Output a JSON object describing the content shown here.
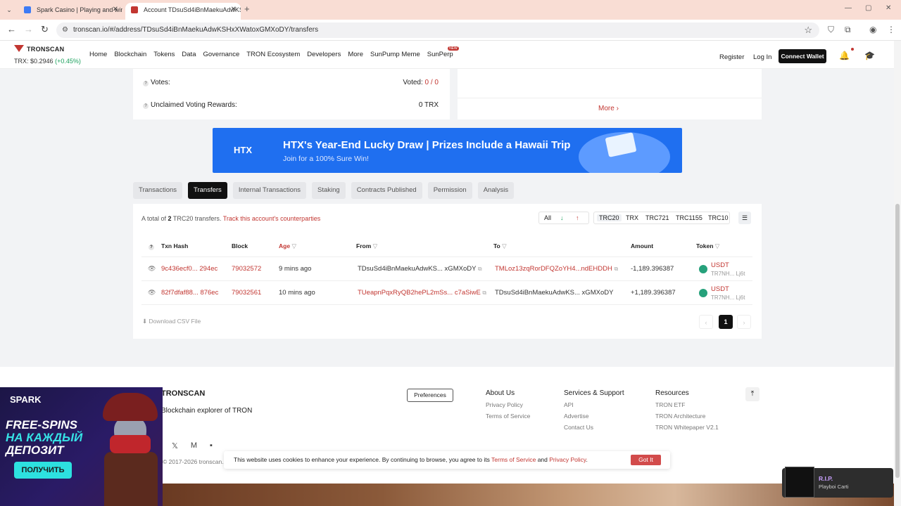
{
  "browser": {
    "tabs": [
      {
        "title": "Spark Casino | Playing and win",
        "favicon_color": "#3d7bf5"
      },
      {
        "title": "Account TDsuSd4iBnMaekuAdwKS...",
        "favicon_color": "#c23631"
      }
    ],
    "url": "tronscan.io/#/address/TDsuSd4iBnMaekuAdwKSHxXWatoxGMXoDY/transfers"
  },
  "header": {
    "logo": "TRONSCAN",
    "price_label": "TRX:",
    "price_value": "$0.2946",
    "price_change": "(+0.45%)",
    "nav": [
      "Home",
      "Blockchain",
      "Tokens",
      "Data",
      "Governance",
      "TRON Ecosystem",
      "Developers",
      "More",
      "SunPump Meme",
      "SunPerp"
    ],
    "register": "Register",
    "login": "Log In",
    "connect": "Connect Wallet"
  },
  "summary": {
    "votes_label": "Votes:",
    "votes_value_prefix": "Voted: ",
    "votes_value": "0 / 0",
    "rewards_label": "Unclaimed Voting Rewards:",
    "rewards_value": "0 TRX",
    "more": "More"
  },
  "banner": {
    "brand": "HTX",
    "headline": "HTX's Year-End Lucky Draw | Prizes Include a Hawaii Trip",
    "subline": "Join for a 100% Sure Win!"
  },
  "tabs": [
    "Transactions",
    "Transfers",
    "Internal Transactions",
    "Staking",
    "Contracts Published",
    "Permission",
    "Analysis"
  ],
  "transfers": {
    "total_prefix": "A total of ",
    "total_count": "2",
    "total_suffix": " TRC20 transfers.",
    "counterparties_link": "Track this account's counterparties",
    "direction": [
      "All",
      "↓",
      "↑"
    ],
    "token_types": [
      "TRC20",
      "TRX",
      "TRC721",
      "TRC1155",
      "TRC10"
    ],
    "columns": {
      "hash": "Txn Hash",
      "block": "Block",
      "age": "Age",
      "from": "From",
      "to": "To",
      "amount": "Amount",
      "token": "Token"
    },
    "rows": [
      {
        "hash": "9c436ecf0... 294ec",
        "block": "79032572",
        "age": "9 mins ago",
        "from": "TDsuSd4iBnMaekuAdwKS... xGMXoDY",
        "to": "TMLoz13zqRorDFQZoYH4...ndEHDDH",
        "amount": "-1,189.396387",
        "token": "USDT",
        "token_addr": "TR7NH... Lj6t"
      },
      {
        "hash": "82f7dfaf88... 876ec",
        "block": "79032561",
        "age": "10 mins ago",
        "from": "TUeapnPqxRyQB2hePL2mSs... c7aSiwE",
        "to": "TDsuSd4iBnMaekuAdwKS... xGMXoDY",
        "amount": "+1,189.396387",
        "token": "USDT",
        "token_addr": "TR7NH... Lj6t"
      }
    ],
    "csv": "Download CSV File",
    "page": "1"
  },
  "footer": {
    "brand": "TRONSCAN",
    "tagline": "Blockchain explorer of TRON",
    "copyright": "2017-2026 tronscan.io",
    "preferences": "Preferences",
    "about": {
      "title": "About Us",
      "items": [
        "Privacy Policy",
        "Terms of Service"
      ]
    },
    "services": {
      "title": "Services & Support",
      "items": [
        "API",
        "Advertise",
        "Contact Us"
      ]
    },
    "resources": {
      "title": "Resources",
      "items": [
        "TRON ETF",
        "TRON Architecture",
        "TRON Whitepaper V2.1"
      ]
    }
  },
  "cookie": {
    "text_before": "This website uses cookies to enhance your experience. By continuing to browse, you agree to its ",
    "terms": "Terms of Service",
    "and": " and ",
    "privacy": "Privacy Policy",
    "dot": ".",
    "button": "Got It"
  },
  "ad": {
    "brand": "SPARK",
    "line1": "FREE-SPINS",
    "line2": "НА КАЖДЫЙ",
    "line3": "ДЕПОЗИТ",
    "cta": "ПОЛУЧИТЬ"
  },
  "media": {
    "title": "R.I.P.",
    "artist": "Playboi Carti"
  }
}
